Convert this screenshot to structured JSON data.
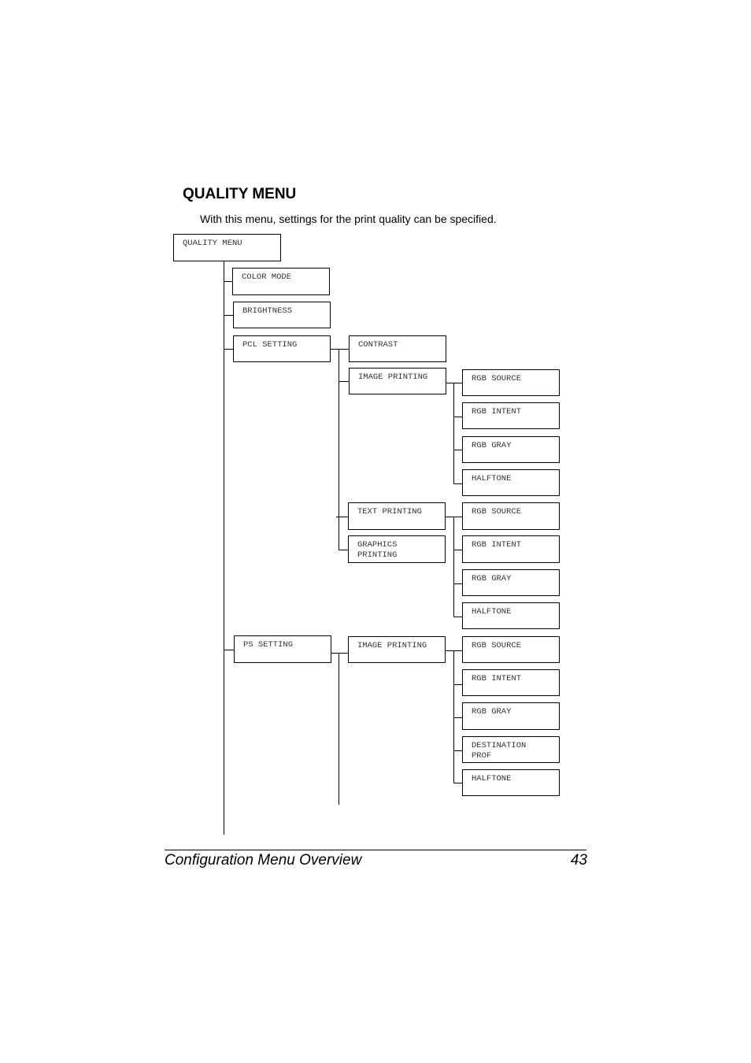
{
  "section": {
    "title": "QUALITY MENU",
    "intro": "With this menu, settings for the print quality can be specified."
  },
  "tree": {
    "root": "QUALITY MENU",
    "level1": [
      "COLOR MODE",
      "BRIGHTNESS",
      "PCL SETTING",
      "PS SETTING"
    ],
    "pcl": {
      "children": [
        "CONTRAST",
        "IMAGE PRINTING",
        "TEXT PRINTING",
        "GRAPHICS\nPRINTING"
      ],
      "image_printing": [
        "RGB SOURCE",
        "RGB INTENT",
        "RGB GRAY",
        "HALFTONE"
      ],
      "text_graphics_printing": [
        "RGB SOURCE",
        "RGB INTENT",
        "RGB GRAY",
        "HALFTONE"
      ]
    },
    "ps": {
      "children": [
        "IMAGE PRINTING"
      ],
      "image_printing": [
        "RGB SOURCE",
        "RGB INTENT",
        "RGB GRAY",
        "DESTINATION\nPROF",
        "HALFTONE"
      ]
    }
  },
  "footer": {
    "section_name": "Configuration Menu Overview",
    "page_number": "43"
  }
}
